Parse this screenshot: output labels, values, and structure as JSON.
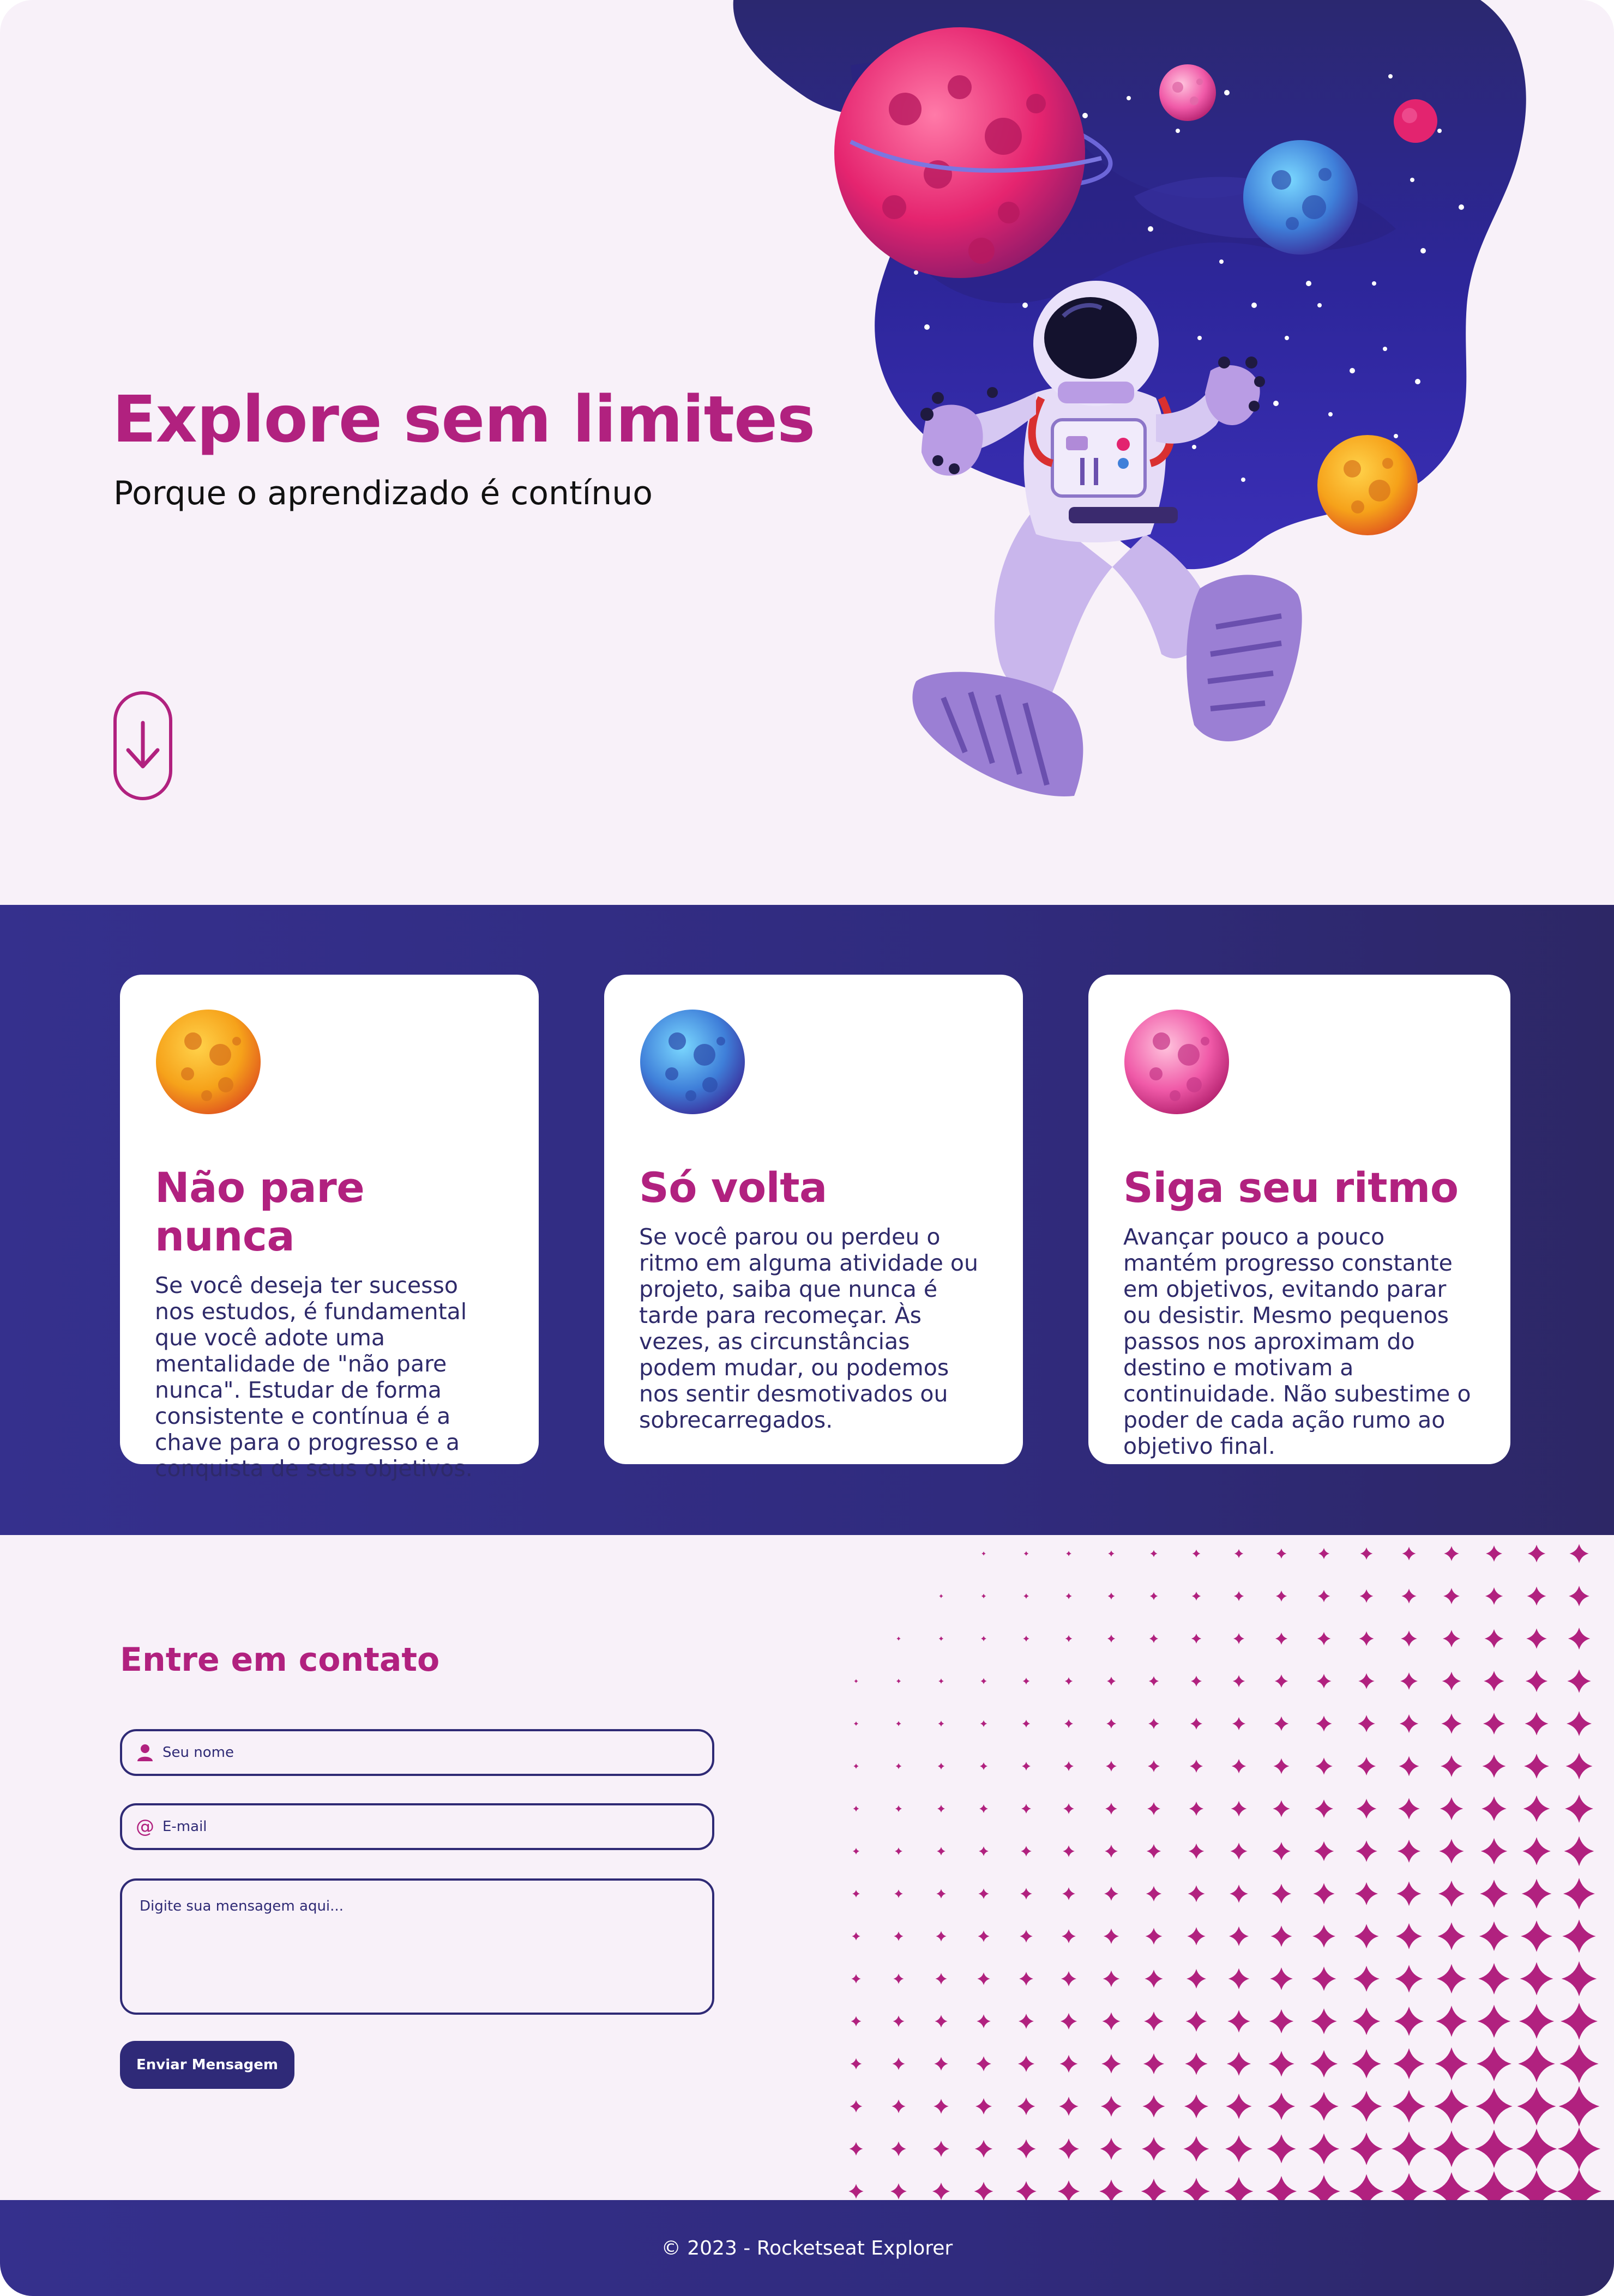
{
  "hero": {
    "title": "Explore sem limites",
    "subtitle": "Porque o aprendizado é contínuo",
    "scroll_icon": "arrow-down-icon"
  },
  "cards": [
    {
      "planet_icon": "orange-planet-icon",
      "title": "Não pare nunca",
      "text": "Se você deseja ter sucesso nos estudos, é fundamental que você adote uma mentalidade de \"não pare nunca\". Estudar de forma consistente e contínua é a chave para o progresso e a conquista de seus objetivos."
    },
    {
      "planet_icon": "blue-planet-icon",
      "title": "Só volta",
      "text": "Se você parou ou perdeu o ritmo em alguma atividade ou projeto, saiba que nunca é tarde para recomeçar. Às vezes, as circunstâncias podem mudar, ou podemos nos sentir desmotivados ou sobrecarregados."
    },
    {
      "planet_icon": "pink-planet-icon",
      "title": "Siga seu ritmo",
      "text": "Avançar pouco a pouco mantém progresso constante em objetivos, evitando parar ou desistir. Mesmo pequenos passos nos aproximam do destino e motivam a continuidade. Não subestime o poder de cada ação rumo ao objetivo final."
    }
  ],
  "contact": {
    "title": "Entre em contato",
    "name_placeholder": "Seu nome",
    "email_placeholder": "E-mail",
    "message_placeholder": "Digite sua mensagem aqui...",
    "submit_label": "Enviar Mensagem"
  },
  "footer": {
    "text": "© 2023 - Rocketseat Explorer"
  },
  "colors": {
    "accent": "#b1217f",
    "dark_blue": "#2f2a78",
    "background": "#f8f1f9"
  }
}
